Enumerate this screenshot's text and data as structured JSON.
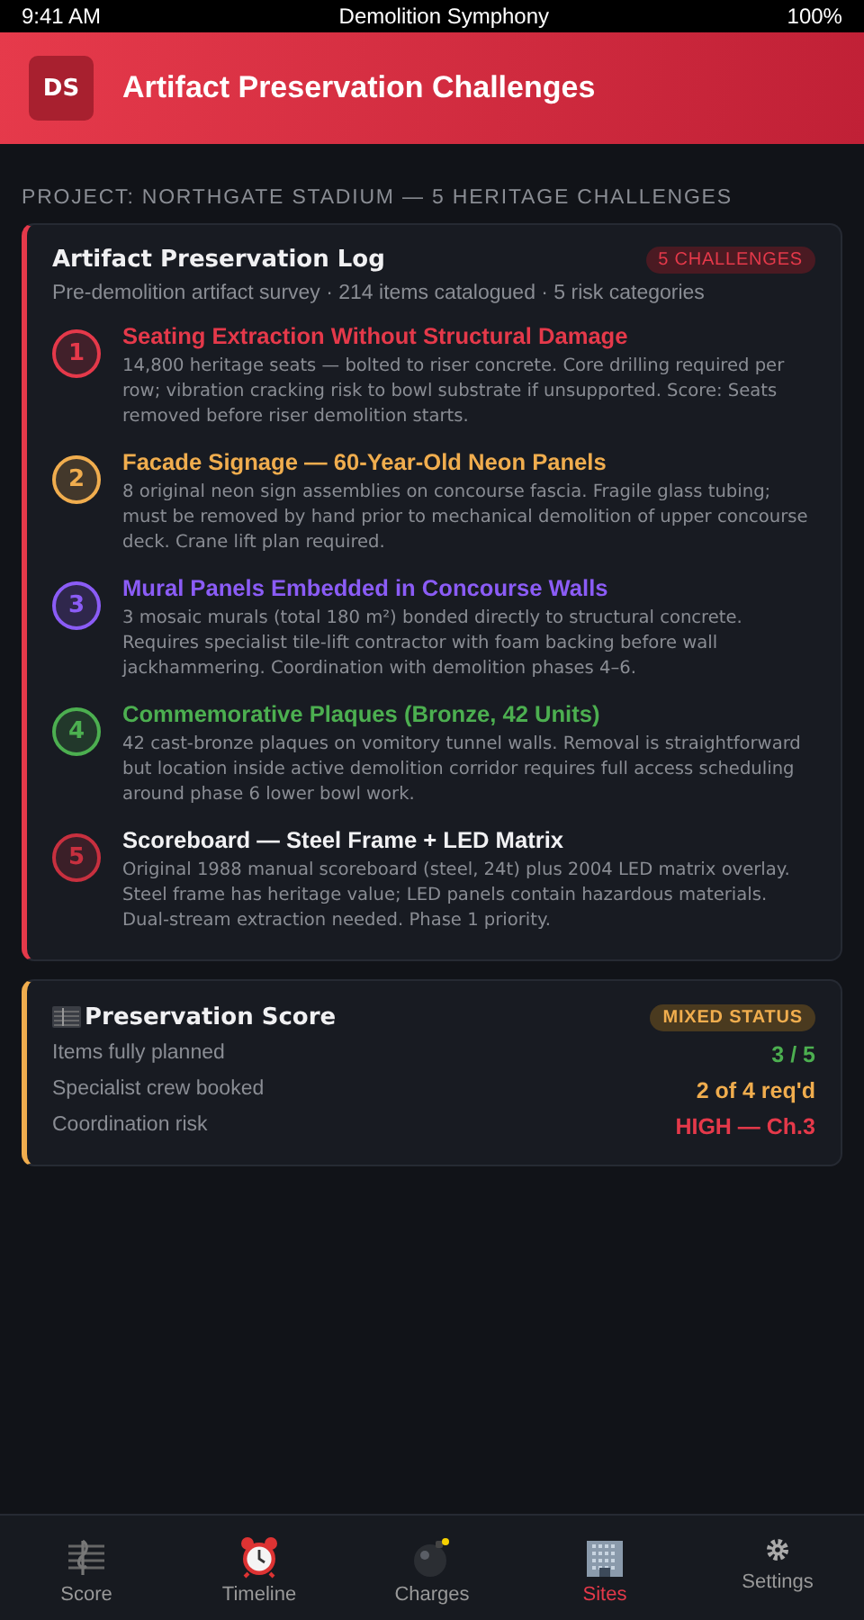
{
  "status_bar": {
    "time": "9:41 AM",
    "title": "Demolition Symphony",
    "battery": "100%"
  },
  "header": {
    "logo": "DS",
    "title": "Artifact Preservation Challenges"
  },
  "section_label": "PROJECT: NORTHGATE STADIUM — 5 HERITAGE CHALLENGES",
  "log_card": {
    "title": "Artifact Preservation Log",
    "badge": "5 CHALLENGES",
    "subtitle": "Pre-demolition artifact survey · 214 items catalogued · 5 risk categories",
    "items": [
      {
        "number": "1",
        "color": "#e5394a",
        "kind": "tinted",
        "title": "Seating Extraction Without Structural Damage",
        "text": "14,800 heritage seats — bolted to riser concrete. Core drilling required per row; vibration cracking risk to bowl substrate if unsupported. Score: Seats removed before riser demolition starts."
      },
      {
        "number": "2",
        "color": "#f0ad4e",
        "kind": "tinted",
        "title": "Facade Signage — 60-Year-Old Neon Panels",
        "text": "8 original neon sign assemblies on concourse fascia. Fragile glass tubing; must be removed by hand prior to mechanical demolition of upper concourse deck. Crane lift plan required."
      },
      {
        "number": "3",
        "color": "#8b5cf6",
        "kind": "tinted",
        "title": "Mural Panels Embedded in Concourse Walls",
        "text": "3 mosaic murals (total 180 m²) bonded directly to structural concrete. Requires specialist tile-lift contractor with foam backing before wall jackhammering. Coordination with demolition phases 4–6."
      },
      {
        "number": "4",
        "color": "#4caf50",
        "kind": "tinted",
        "title": "Commemorative Plaques (Bronze, 42 Units)",
        "text": "42 cast-bronze plaques on vomitory tunnel walls. Removal is straightforward but location inside active demolition corridor requires full access scheduling around phase 6 lower bowl work."
      },
      {
        "number": "5",
        "color": "#c8303f",
        "kind": "plain",
        "title": "Scoreboard — Steel Frame + LED Matrix",
        "text": "Original 1988 manual scoreboard (steel, 24t) plus 2004 LED matrix overlay. Steel frame has heritage value; LED panels contain hazardous materials. Dual-stream extraction needed. Phase 1 priority."
      }
    ]
  },
  "score_card": {
    "title": "Preservation Score",
    "badge": "MIXED STATUS",
    "rows": [
      {
        "label": "Items fully planned",
        "value": "3 / 5",
        "color": "#4caf50"
      },
      {
        "label": "Specialist crew booked",
        "value": "2 of 4 req'd",
        "color": "#f0ad4e"
      },
      {
        "label": "Coordination risk",
        "value": "HIGH — Ch.3",
        "color": "#e5394a"
      }
    ]
  },
  "tabs": [
    {
      "label": "Score",
      "selected": false
    },
    {
      "label": "Timeline",
      "selected": false
    },
    {
      "label": "Charges",
      "selected": false
    },
    {
      "label": "Sites",
      "selected": true
    },
    {
      "label": "Settings",
      "selected": false
    }
  ]
}
